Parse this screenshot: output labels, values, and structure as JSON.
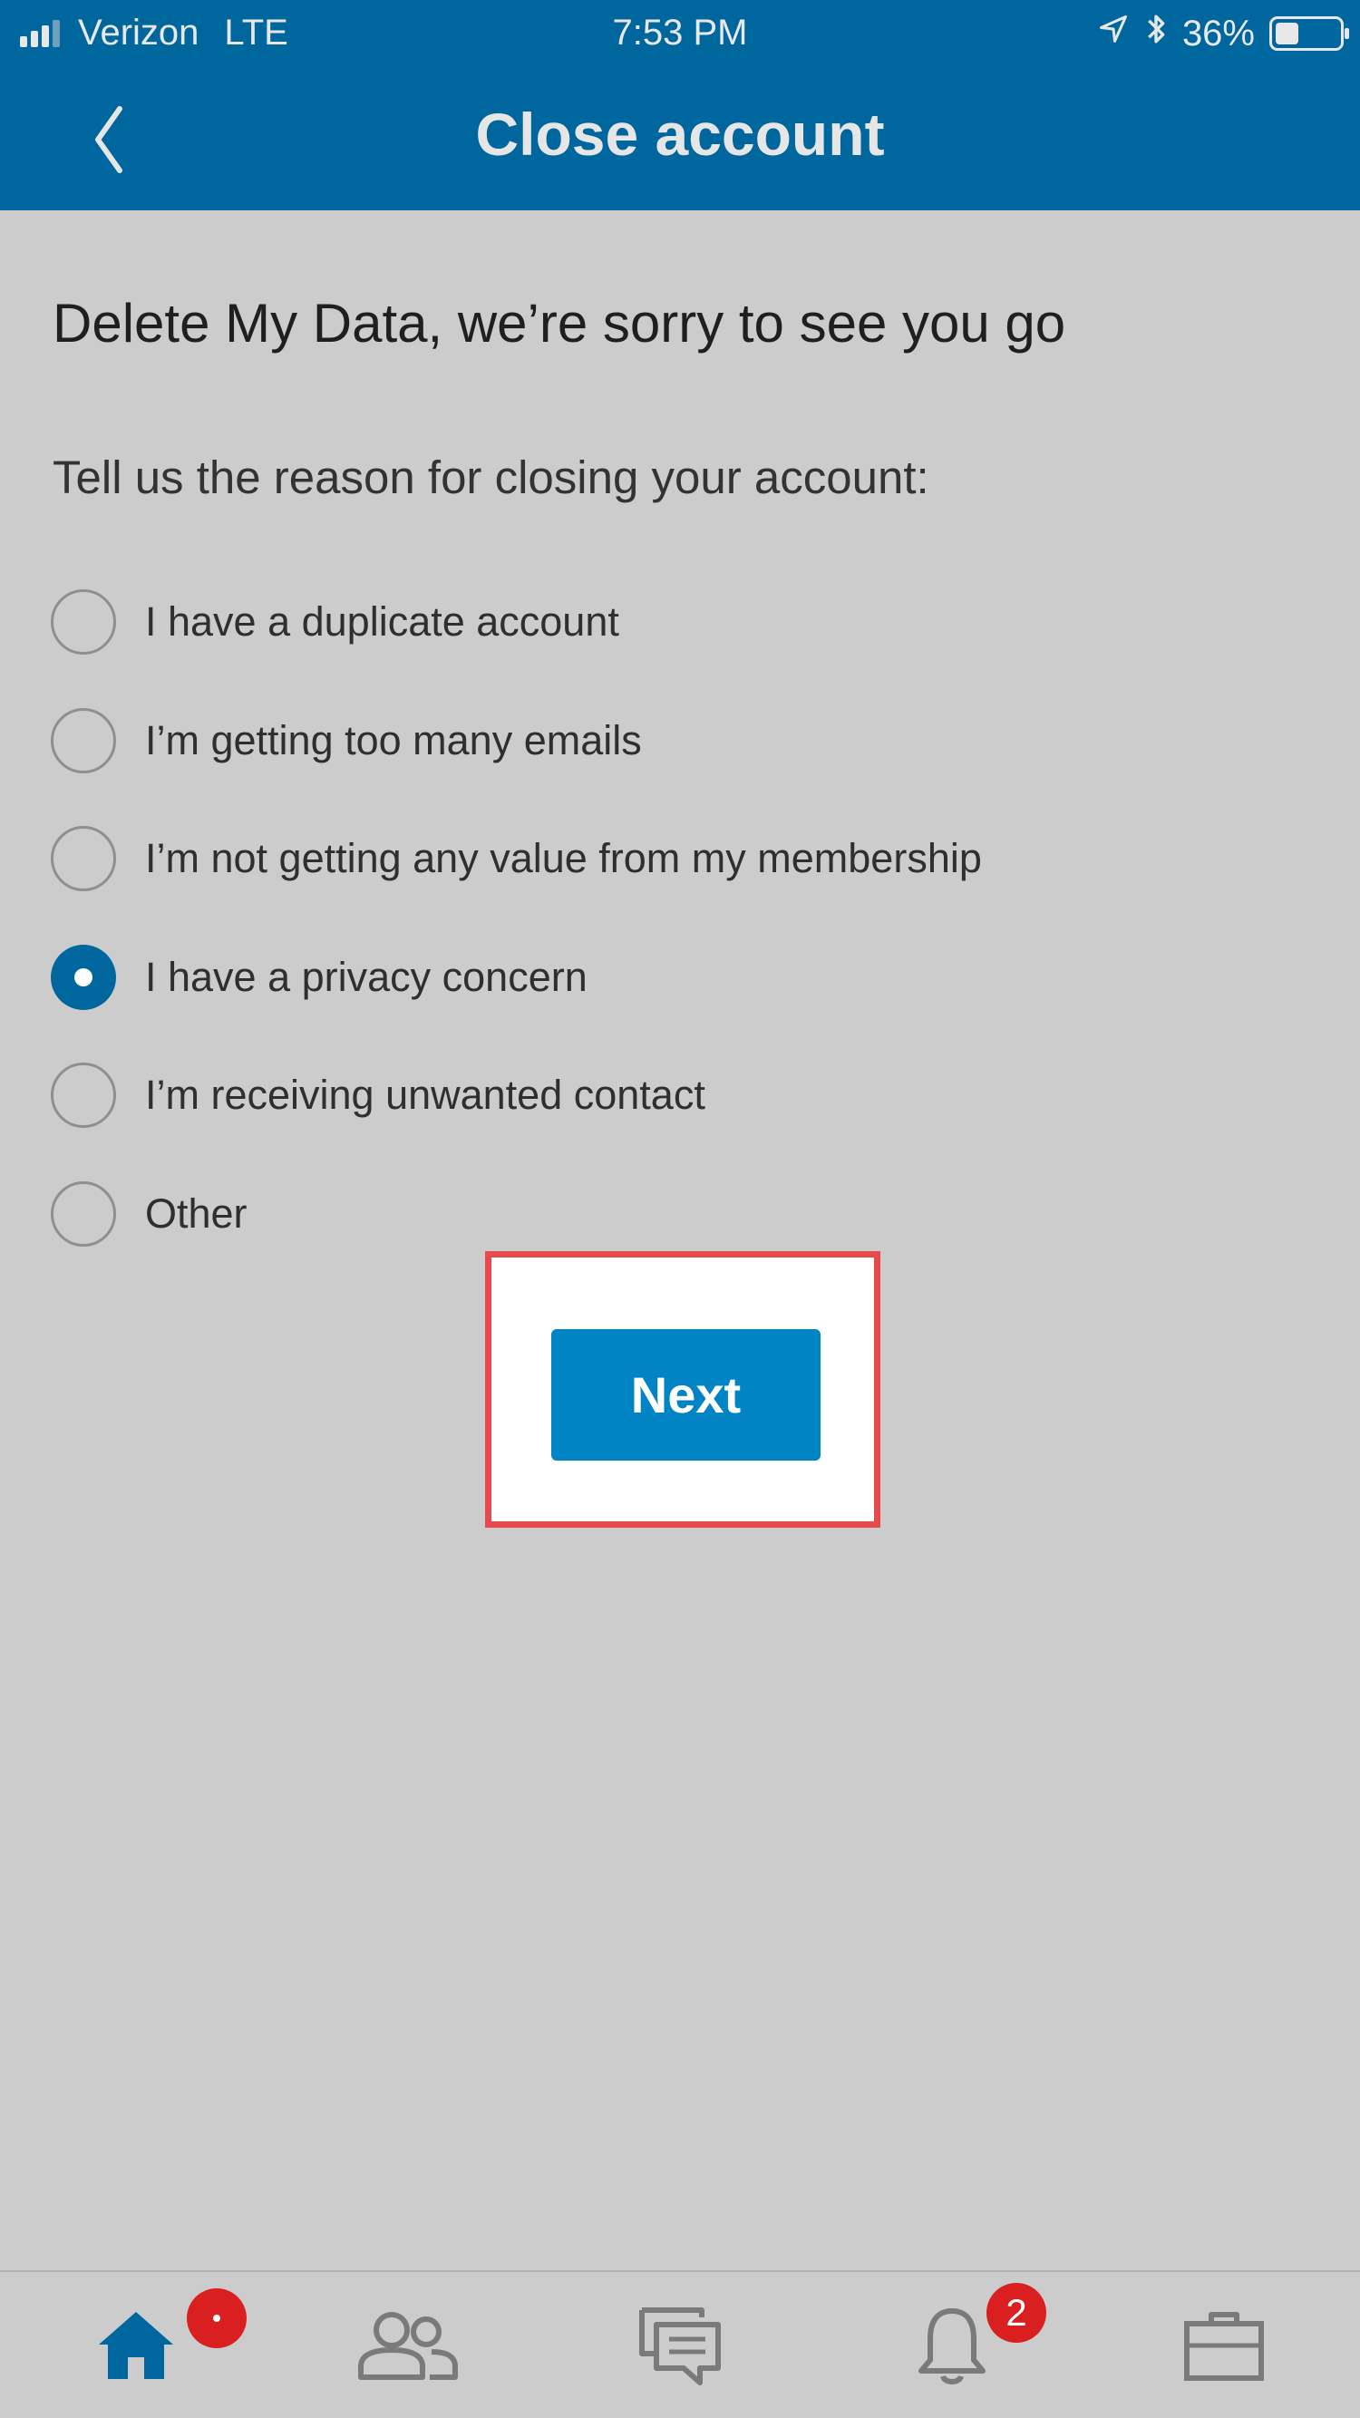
{
  "status_bar": {
    "carrier": "Verizon",
    "network": "LTE",
    "time": "7:53 PM",
    "battery_percent": "36%",
    "battery_level": 0.36,
    "icons": [
      "signal-icon",
      "location-arrow-icon",
      "bluetooth-icon",
      "battery-icon"
    ]
  },
  "nav": {
    "title": "Close account",
    "back_icon": "chevron-left-icon"
  },
  "content": {
    "heading": "Delete My Data, we’re sorry to see you go",
    "prompt": "Tell us the reason for closing your account:",
    "options": [
      {
        "label": "I have a duplicate account",
        "selected": false
      },
      {
        "label": "I’m getting too many emails",
        "selected": false
      },
      {
        "label": "I’m not getting any value from my membership",
        "selected": false
      },
      {
        "label": "I have a privacy concern",
        "selected": true
      },
      {
        "label": "I’m receiving unwanted contact",
        "selected": false
      },
      {
        "label": "Other",
        "selected": false
      }
    ],
    "next_label": "Next"
  },
  "tabbar": {
    "tabs": [
      {
        "icon": "home-icon",
        "active": true,
        "badge": "•"
      },
      {
        "icon": "people-icon",
        "active": false,
        "badge": ""
      },
      {
        "icon": "messages-icon",
        "active": false,
        "badge": ""
      },
      {
        "icon": "bell-icon",
        "active": false,
        "badge": "2"
      },
      {
        "icon": "briefcase-icon",
        "active": false,
        "badge": ""
      }
    ]
  },
  "colors": {
    "header_bg": "#00679e",
    "button_bg": "#0084c4",
    "badge_bg": "#d91f1f",
    "highlight_border": "#e8494c",
    "page_bg": "#cccccc"
  }
}
